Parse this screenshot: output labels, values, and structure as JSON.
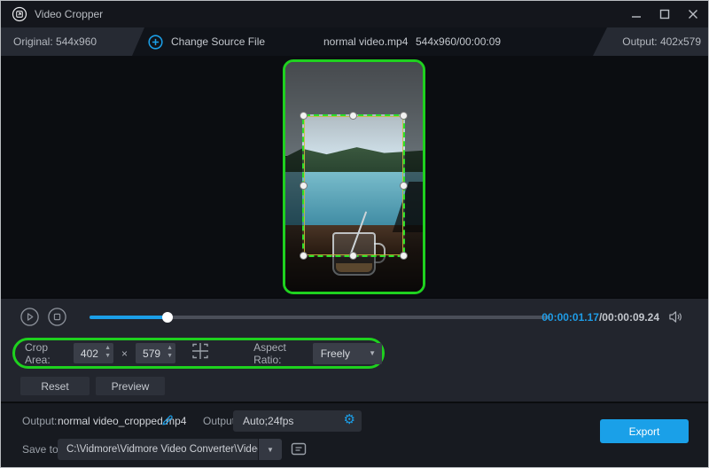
{
  "window": {
    "title": "Video Cropper"
  },
  "titlebar": {
    "minimize_icon": "minimize-icon",
    "maximize_icon": "maximize-icon",
    "close_icon": "close-icon"
  },
  "infobar": {
    "original_label": "Original: 544x960",
    "change_source_label": "Change Source File",
    "filename": "normal video.mp4",
    "file_info": "544x960/00:00:09",
    "output_label": "Output: 402x579"
  },
  "player": {
    "current_time": "00:00:01.17",
    "total_time": "/00:00:09.24",
    "progress_percent": 17
  },
  "crop_controls": {
    "crop_area_label": "Crop Area:",
    "width_value": "402",
    "multiply_sign": "×",
    "height_value": "579",
    "aspect_ratio_label": "Aspect Ratio:",
    "aspect_ratio_value": "Freely",
    "dropdown_arrow": "▼",
    "spinner_up": "▲",
    "spinner_down": "▼"
  },
  "actions": {
    "reset_label": "Reset",
    "preview_label": "Preview"
  },
  "output_section": {
    "output_label": "Output:",
    "output_filename": "normal video_cropped.mp4",
    "format_label": "Output:",
    "format_value": "Auto;24fps",
    "gear_glyph": "⚙",
    "save_to_label": "Save to:",
    "save_path": "C:\\Vidmore\\Vidmore Video Converter\\Video Crop",
    "path_arrow": "▼",
    "export_label": "Export"
  },
  "colors": {
    "accent_blue": "#1b9fe8",
    "highlight_green": "#1ed11e",
    "panel_dark": "#22252d",
    "titlebar": "#14161c",
    "time_current": "#1f9ce6"
  }
}
